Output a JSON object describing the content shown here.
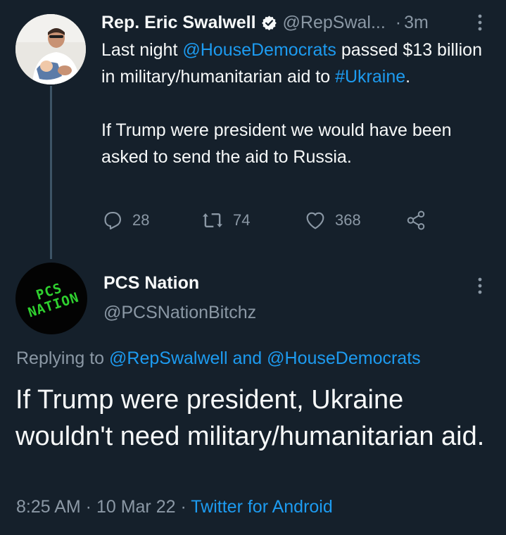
{
  "tweet": {
    "author_name": "Rep. Eric Swalwell",
    "verified_icon": "verified-badge-icon",
    "handle": "@RepSwal...",
    "separator": "·",
    "time_ago": "3m",
    "text_part1": "Last night ",
    "mention": "@HouseDemocrats",
    "text_part2": " passed $13 billion in military/humanitarian aid to ",
    "hashtag": "#Ukraine",
    "text_part3": ".",
    "paragraph2": "If Trump were president we would have been asked to send the aid to Russia.",
    "reply_count": "28",
    "retweet_count": "74",
    "like_count": "368"
  },
  "reply": {
    "author_name": "PCS Nation",
    "handle": "@PCSNationBitchz",
    "avatar_logo_line1": "PCS",
    "avatar_logo_line2": "NATION",
    "replying_prefix": "Replying to ",
    "replying_user1": "@RepSwalwell",
    "replying_and": " and ",
    "replying_user2": "@HouseDemocrats",
    "text": "If Trump were president, Ukraine wouldn't need military/humanitarian aid.",
    "time": "8:25 AM",
    "meta_sep1": " · ",
    "date": "10 Mar 22",
    "meta_sep2": " · ",
    "source": "Twitter for Android"
  },
  "colors": {
    "background": "#15202b",
    "text": "#f7f9f9",
    "secondary": "#8b98a5",
    "link": "#1d9bf0",
    "thread_line": "#3d5466",
    "logo_green": "#2fd12f"
  }
}
